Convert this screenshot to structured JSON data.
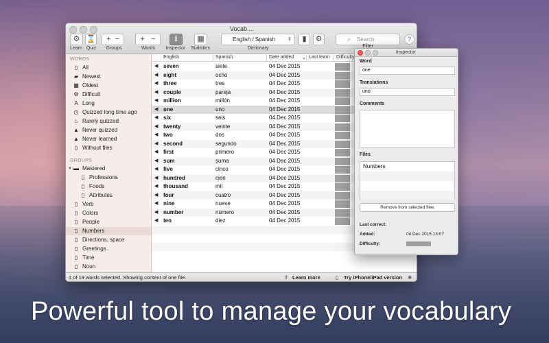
{
  "background": {
    "tagline": "Powerful tool to manage your vocabulary"
  },
  "window": {
    "title": "Vocab ...",
    "toolbar": {
      "learn_label": "Learn",
      "quiz_label": "Quiz",
      "groups_label": "Groups",
      "words_label": "Words",
      "inspector_label": "Inspector",
      "statistics_label": "Statistics",
      "dictionary_label": "Dictionary",
      "filter_label": "Filter",
      "plus_glyph": "+",
      "minus_glyph": "−",
      "language_pair": "English / Spanish",
      "search_placeholder": "Search",
      "help_glyph": "?"
    },
    "sidebar": {
      "words_header": "WORDS",
      "word_filters": [
        {
          "label": "All",
          "icon": "document-icon"
        },
        {
          "label": "Newest",
          "icon": "new-document-icon"
        },
        {
          "label": "Oldest",
          "icon": "calendar-icon"
        },
        {
          "label": "Difficult",
          "icon": "gears-icon"
        },
        {
          "label": "Long",
          "icon": "text-size-icon"
        },
        {
          "label": "Quizzed long time ago",
          "icon": "clock-icon"
        },
        {
          "label": "Rarely quizzed",
          "icon": "flame-icon"
        },
        {
          "label": "Never quizzed",
          "icon": "warning-icon"
        },
        {
          "label": "Never learned",
          "icon": "warning-icon"
        },
        {
          "label": "Without files",
          "icon": "document-icon"
        }
      ],
      "groups_header": "GROUPS",
      "groups": [
        {
          "label": "Mastered",
          "icon": "folder-icon",
          "level": 0
        },
        {
          "label": "Professions",
          "icon": "document-icon",
          "level": 1
        },
        {
          "label": "Foods",
          "icon": "document-icon",
          "level": 1
        },
        {
          "label": "Attributes",
          "icon": "document-icon",
          "level": 1
        },
        {
          "label": "Verb",
          "icon": "document-icon",
          "level": 0
        },
        {
          "label": "Colors",
          "icon": "document-icon",
          "level": 0
        },
        {
          "label": "People",
          "icon": "document-icon",
          "level": 0
        },
        {
          "label": "Numbers",
          "icon": "document-icon",
          "level": 0,
          "selected": true
        },
        {
          "label": "Directions, space",
          "icon": "document-icon",
          "level": 0
        },
        {
          "label": "Greetings",
          "icon": "document-icon",
          "level": 0
        },
        {
          "label": "Time",
          "icon": "document-icon",
          "level": 0
        },
        {
          "label": "Noun",
          "icon": "document-icon",
          "level": 0
        }
      ]
    },
    "table": {
      "columns": {
        "english": "English",
        "spanish": "Spanish",
        "date_added": "Date added",
        "last_learn": "Last learn",
        "difficulty": "Difficulty"
      },
      "rows": [
        {
          "en": "seven",
          "es": "siete",
          "date": "04 Dec 2015"
        },
        {
          "en": "eight",
          "es": "ocho",
          "date": "04 Dec 2015"
        },
        {
          "en": "three",
          "es": "tres",
          "date": "04 Dec 2015"
        },
        {
          "en": "couple",
          "es": "pareja",
          "date": "04 Dec 2015"
        },
        {
          "en": "million",
          "es": "millón",
          "date": "04 Dec 2015"
        },
        {
          "en": "one",
          "es": "uno",
          "date": "04 Dec 2015",
          "selected": true
        },
        {
          "en": "six",
          "es": "seis",
          "date": "04 Dec 2015"
        },
        {
          "en": "twenty",
          "es": "veinte",
          "date": "04 Dec 2015"
        },
        {
          "en": "two",
          "es": "dos",
          "date": "04 Dec 2015"
        },
        {
          "en": "second",
          "es": "segundo",
          "date": "04 Dec 2015"
        },
        {
          "en": "first",
          "es": "primero",
          "date": "04 Dec 2015"
        },
        {
          "en": "sum",
          "es": "suma",
          "date": "04 Dec 2015"
        },
        {
          "en": "five",
          "es": "cinco",
          "date": "04 Dec 2015"
        },
        {
          "en": "hundred",
          "es": "cien",
          "date": "04 Dec 2015"
        },
        {
          "en": "thousand",
          "es": "mil",
          "date": "04 Dec 2015"
        },
        {
          "en": "four",
          "es": "cuatro",
          "date": "04 Dec 2015"
        },
        {
          "en": "nine",
          "es": "nueve",
          "date": "04 Dec 2015"
        },
        {
          "en": "number",
          "es": "número",
          "date": "04 Dec 2015"
        },
        {
          "en": "ten",
          "es": "diez",
          "date": "04 Dec 2015"
        }
      ]
    },
    "statusbar": {
      "selection_text": "1 of 19 words selected. Showing content of one file.",
      "learn_more": "Learn more",
      "try_mobile": "Try iPhone/iPad version"
    }
  },
  "inspector": {
    "title": "Inspector",
    "word_label": "Word",
    "word_value": "one",
    "translations_label": "Translations",
    "translations_value": "uno",
    "comments_label": "Comments",
    "files_label": "Files",
    "files": [
      "Numbers"
    ],
    "remove_button": "Remove from selected files",
    "last_correct_label": "Last correct:",
    "added_label": "Added:",
    "added_value": "04 Dec 2015 13:07",
    "difficulty_label": "Difficulty:"
  }
}
